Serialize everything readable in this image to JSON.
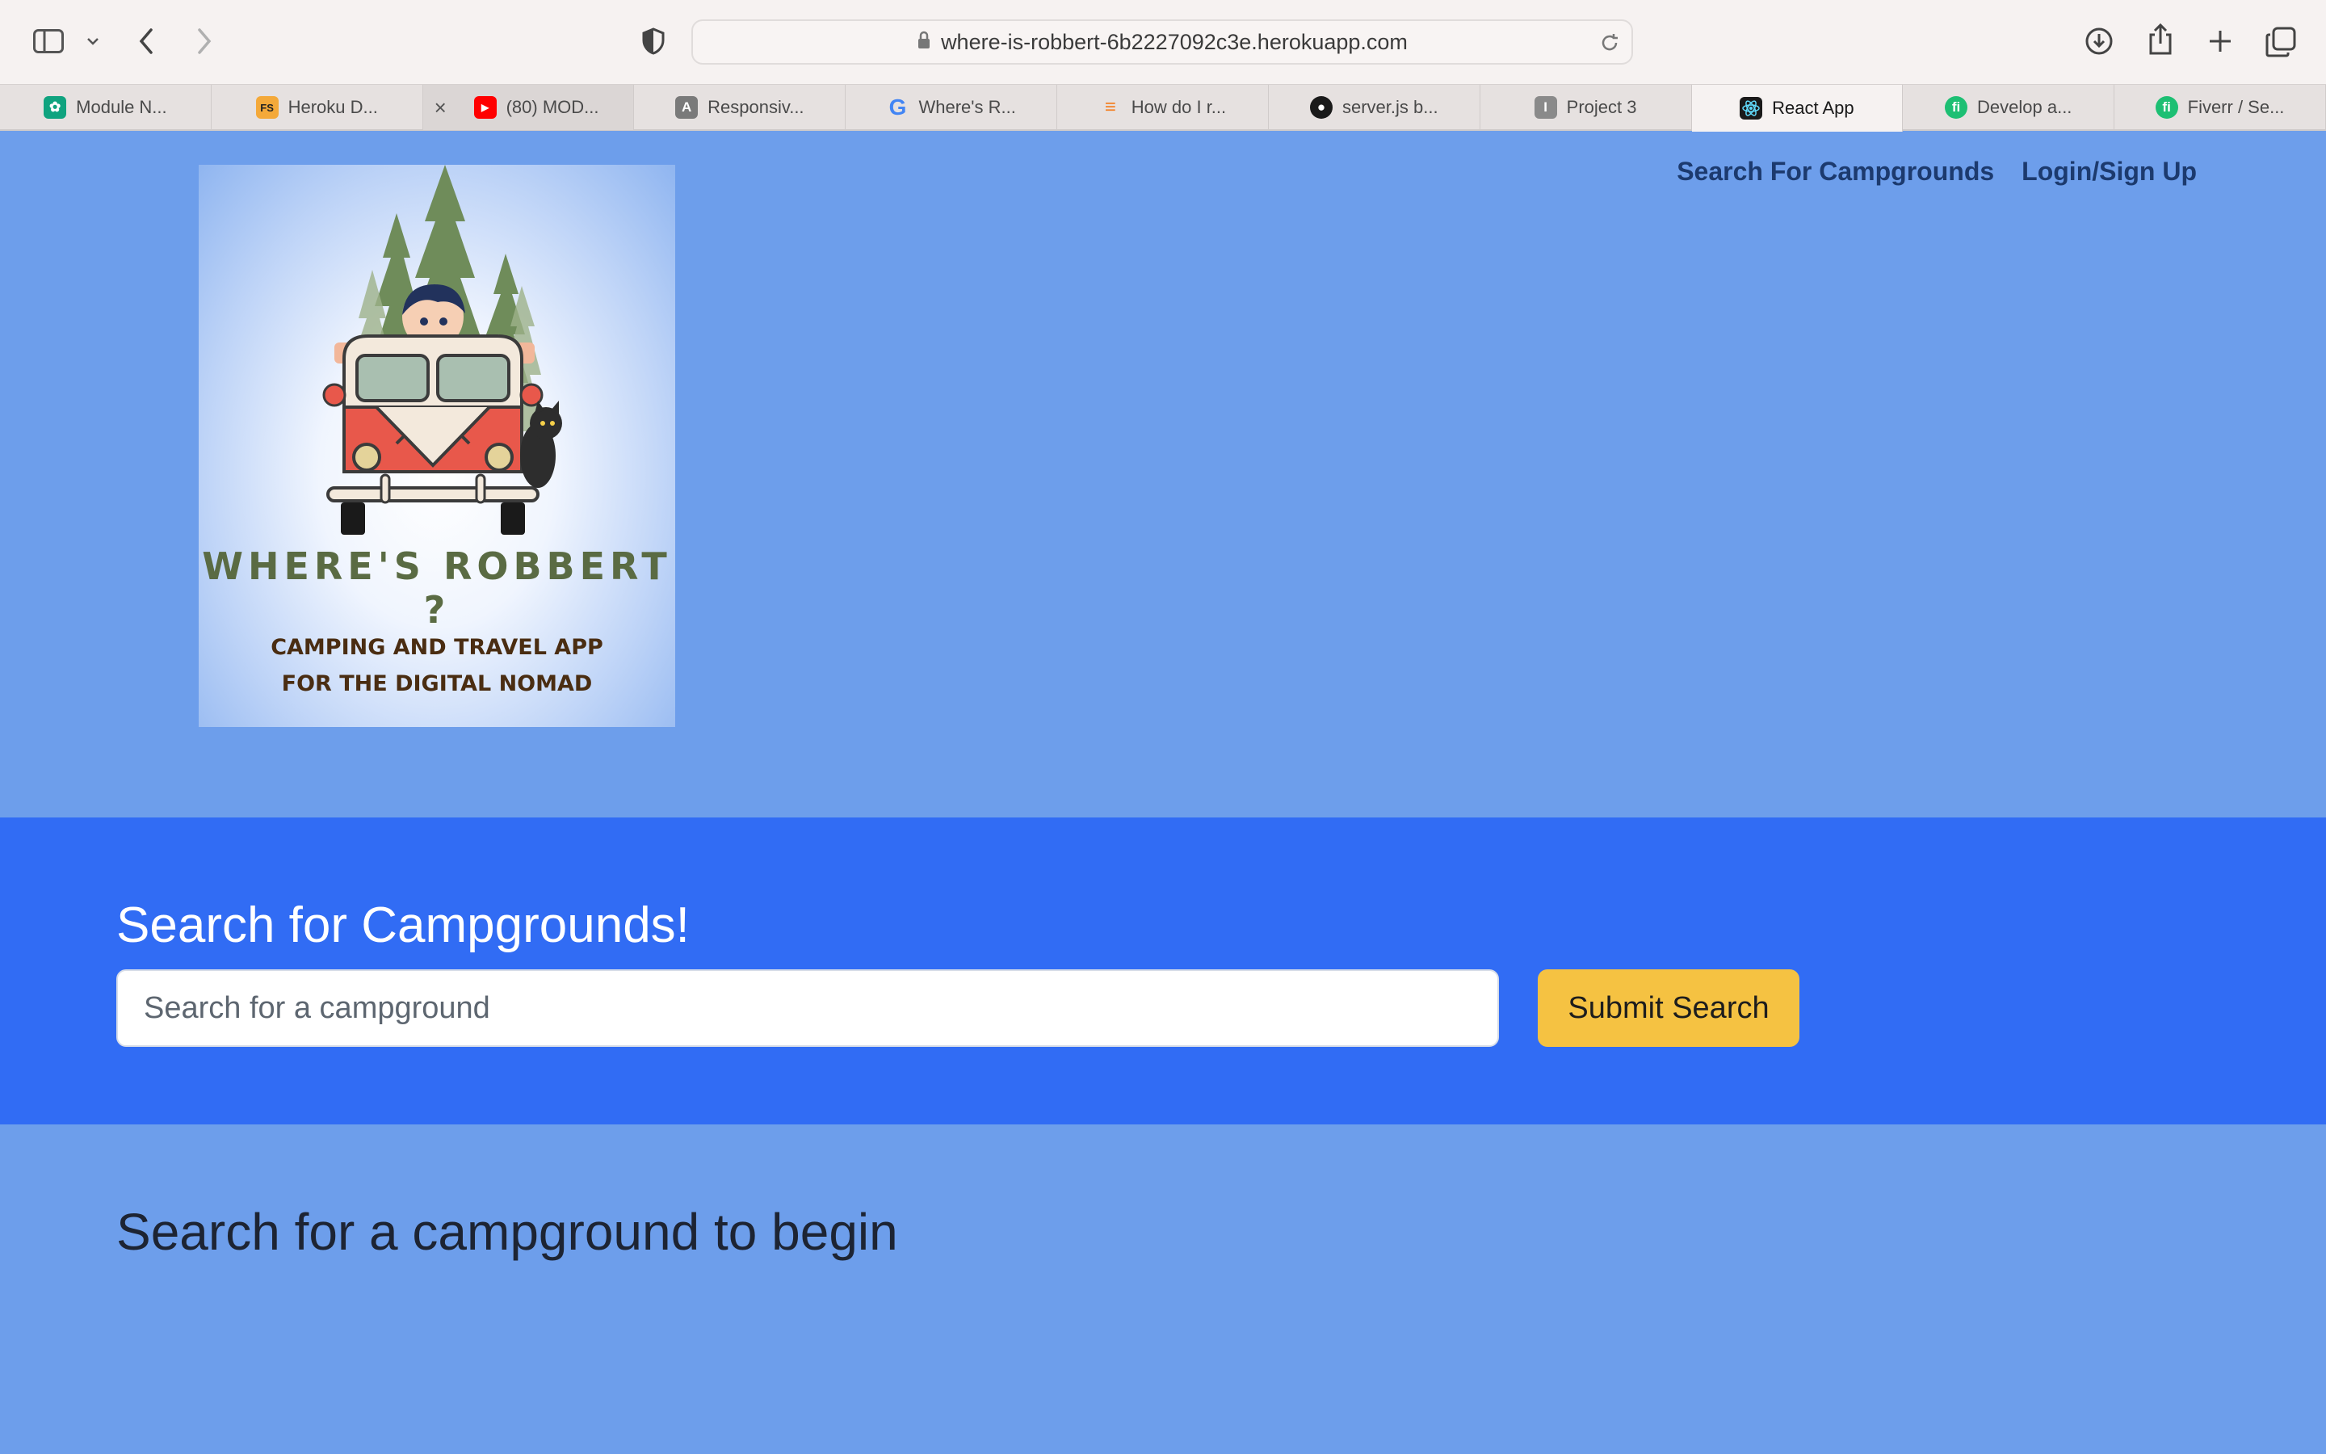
{
  "browser": {
    "url": "where-is-robbert-6b2227092c3e.herokuapp.com",
    "tabs": [
      {
        "label": "Module N...",
        "icon": "openai-icon",
        "color": "#10a37f"
      },
      {
        "label": "Heroku D...",
        "icon": "fs-icon",
        "color": "#f4a93a"
      },
      {
        "label": "(80) MOD...",
        "icon": "youtube-icon",
        "color": "#ff0000"
      },
      {
        "label": "Responsiv...",
        "icon": "a-icon",
        "color": "#7a7a7a"
      },
      {
        "label": "Where's R...",
        "icon": "google-icon",
        "color": "#4285f4"
      },
      {
        "label": "How do I r...",
        "icon": "stackoverflow-icon",
        "color": "#f48024"
      },
      {
        "label": "server.js b...",
        "icon": "github-icon",
        "color": "#1a1a1a"
      },
      {
        "label": "Project 3",
        "icon": "i-icon",
        "color": "#8a8a8a"
      },
      {
        "label": "React App",
        "icon": "react-icon",
        "color": "#1a1a1a"
      },
      {
        "label": "Develop a...",
        "icon": "fiverr-icon",
        "color": "#1dbf73"
      },
      {
        "label": "Fiverr / Se...",
        "icon": "fiverr-icon",
        "color": "#1dbf73"
      }
    ]
  },
  "nav": {
    "search": "Search For Campgrounds",
    "login": "Login/Sign Up"
  },
  "logo": {
    "title": "WHERE'S ROBBERT ?",
    "subtitle_line1": "CAMPING AND TRAVEL APP",
    "subtitle_line2": "FOR THE DIGITAL NOMAD"
  },
  "search": {
    "heading": "Search for Campgrounds!",
    "placeholder": "Search for a campground",
    "submit": "Submit Search"
  },
  "results": {
    "empty_message": "Search for a campground to begin"
  }
}
